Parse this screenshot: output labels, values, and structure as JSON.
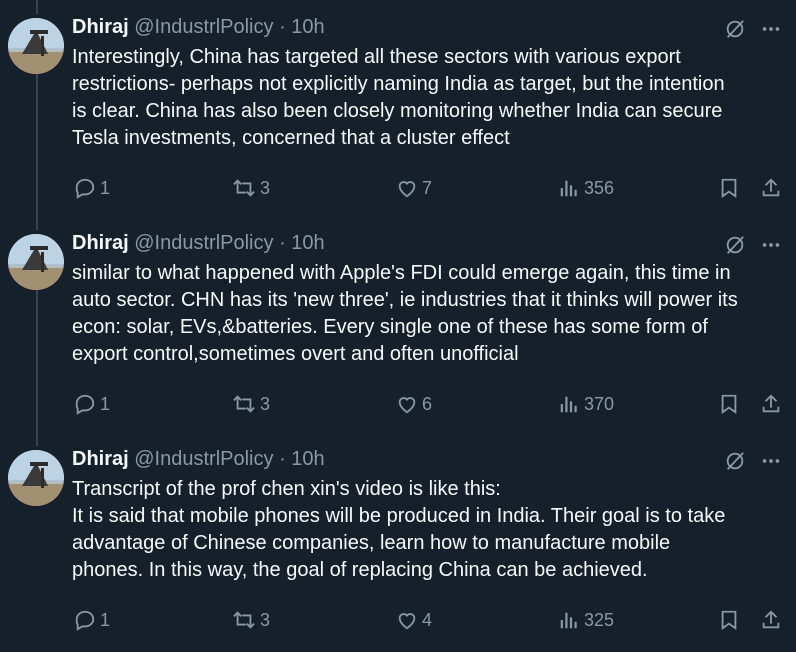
{
  "tweets": [
    {
      "name": "Dhiraj",
      "handle": "@IndustrlPolicy",
      "separator": "·",
      "time": "10h",
      "lines": [
        "Interestingly, China has targeted all these sectors with various export",
        "restrictions- perhaps not explicitly naming India as target, but the intention",
        "is clear. China has also been closely monitoring whether India can secure",
        "Tesla investments, concerned that a cluster effect"
      ],
      "replies": "1",
      "reposts": "3",
      "likes": "7",
      "views": "356"
    },
    {
      "name": "Dhiraj",
      "handle": "@IndustrlPolicy",
      "separator": "·",
      "time": "10h",
      "lines": [
        "similar to what happened with Apple's FDI could emerge again, this time in",
        "auto sector. CHN has its 'new three', ie industries that it thinks will power its",
        "econ: solar, EVs,&batteries. Every single one of these has some form of",
        "export control,sometimes overt and often unofficial"
      ],
      "replies": "1",
      "reposts": "3",
      "likes": "6",
      "views": "370"
    },
    {
      "name": "Dhiraj",
      "handle": "@IndustrlPolicy",
      "separator": "·",
      "time": "10h",
      "lines": [
        "Transcript of the prof chen xin's video is like this:",
        "It is said that mobile phones will be produced in India. Their goal is to take",
        "advantage of Chinese companies, learn how to manufacture mobile",
        "phones. In this way, the goal of replacing China can be achieved."
      ],
      "replies": "1",
      "reposts": "3",
      "likes": "4",
      "views": "325"
    }
  ],
  "icons": {
    "reply": "reply-icon",
    "repost": "repost-icon",
    "like": "heart-icon",
    "views": "views-icon",
    "bookmark": "bookmark-icon",
    "share": "share-icon",
    "grok": "grok-icon",
    "more": "more-icon"
  },
  "colors": {
    "background": "#15202b",
    "text": "#f7f9f9",
    "muted": "#8b98a5",
    "thread_line": "#38444d"
  }
}
